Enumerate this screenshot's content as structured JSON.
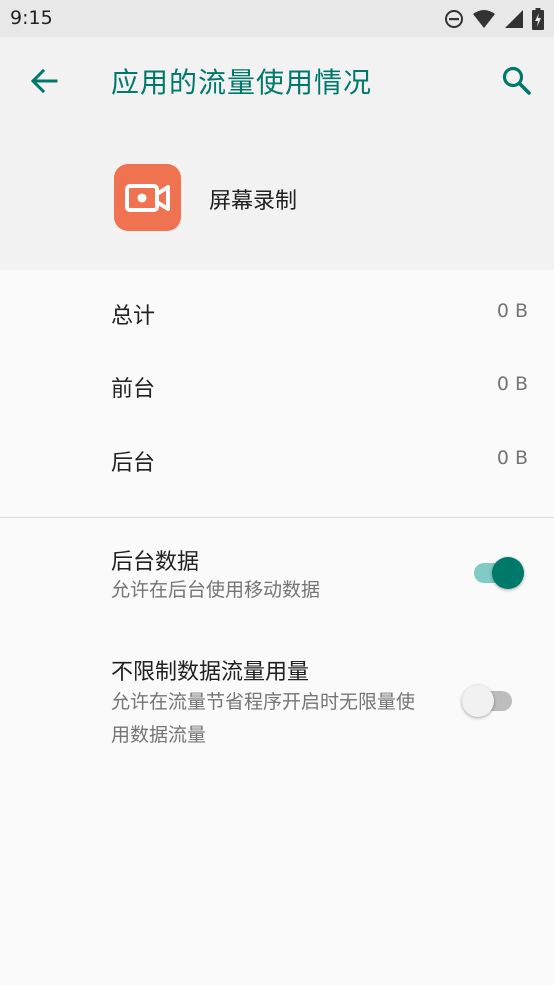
{
  "status_bar": {
    "time": "9:15",
    "icons": [
      "do-not-disturb-icon",
      "wifi-icon",
      "cell-signal-icon",
      "battery-icon"
    ]
  },
  "app_bar": {
    "title": "应用的流量使用情况",
    "back_icon": "arrow-back-icon",
    "search_icon": "search-icon"
  },
  "app": {
    "name": "屏幕录制",
    "icon": "video-camera-icon",
    "icon_color": "#ef7350"
  },
  "usage": [
    {
      "label": "总计",
      "value": "0 B"
    },
    {
      "label": "前台",
      "value": "0 B"
    },
    {
      "label": "后台",
      "value": "0 B"
    }
  ],
  "preferences": {
    "background_data": {
      "title": "后台数据",
      "summary": "允许在后台使用移动数据",
      "enabled": true
    },
    "unrestricted_data": {
      "title": "不限制数据流量用量",
      "summary": "允许在流量节省程序开启时无限量使用数据流量",
      "enabled": false
    }
  },
  "colors": {
    "accent": "#00796b",
    "switch_on_track": "#80cbc4",
    "switch_off_track": "#bdbdbd"
  }
}
